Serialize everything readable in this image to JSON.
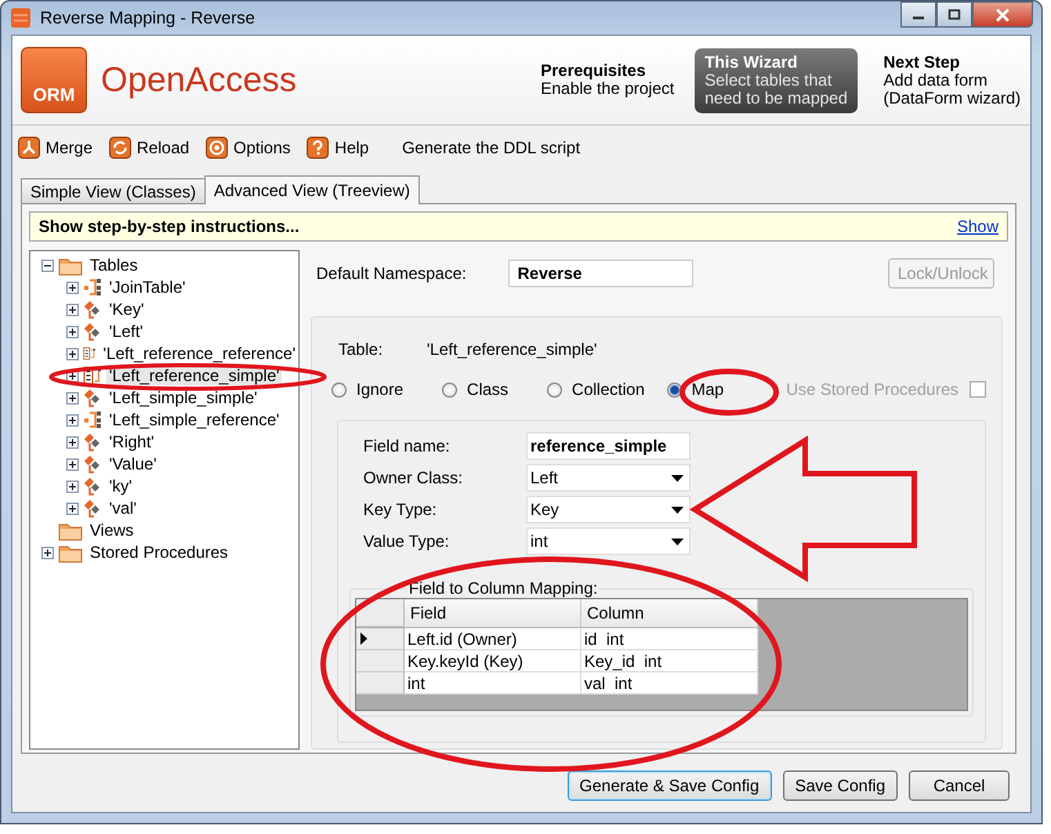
{
  "window": {
    "title": "Reverse Mapping - Reverse"
  },
  "header": {
    "logo_text": "ORM",
    "brand": "OpenAccess",
    "steps": [
      {
        "title": "Prerequisites",
        "lines": [
          "Enable the project"
        ],
        "selected": false
      },
      {
        "title": "This Wizard",
        "lines": [
          "Select tables that",
          "need to be mapped"
        ],
        "selected": true
      },
      {
        "title": "Next Step",
        "lines": [
          "Add data form",
          "(DataForm wizard)"
        ],
        "selected": false
      }
    ]
  },
  "toolbar": [
    {
      "label": "Merge",
      "kind": "merge"
    },
    {
      "label": "Reload",
      "kind": "reload"
    },
    {
      "label": "Options",
      "kind": "options"
    },
    {
      "label": "Help",
      "kind": "help"
    },
    {
      "label": "Generate the DDL script",
      "kind": "text"
    }
  ],
  "tabs": [
    {
      "label": "Simple View (Classes)",
      "selected": false
    },
    {
      "label": "Advanced View (Treeview)",
      "selected": true
    }
  ],
  "info_bar": {
    "text": "Show step-by-step instructions...",
    "link": "Show"
  },
  "tree": [
    {
      "label": "Tables",
      "expanded": true,
      "children": [
        {
          "label": "'JoinTable'",
          "kind": "join",
          "expanded": false,
          "selected": false
        },
        {
          "label": "'Key'",
          "kind": "class",
          "expanded": false,
          "selected": false
        },
        {
          "label": "'Left'",
          "kind": "class",
          "expanded": false,
          "selected": false
        },
        {
          "label": "'Left_reference_reference'",
          "kind": "map",
          "expanded": false,
          "selected": false
        },
        {
          "label": "'Left_reference_simple'",
          "kind": "map",
          "expanded": false,
          "selected": true
        },
        {
          "label": "'Left_simple_simple'",
          "kind": "class",
          "expanded": false,
          "selected": false
        },
        {
          "label": "'Left_simple_reference'",
          "kind": "join",
          "expanded": false,
          "selected": false
        },
        {
          "label": "'Right'",
          "kind": "class",
          "expanded": false,
          "selected": false
        },
        {
          "label": "'Value'",
          "kind": "class",
          "expanded": false,
          "selected": false
        },
        {
          "label": "'ky'",
          "kind": "class",
          "expanded": false,
          "selected": false
        },
        {
          "label": "'val'",
          "kind": "class",
          "expanded": false,
          "selected": false
        }
      ]
    },
    {
      "label": "Views",
      "kind": "leaf"
    },
    {
      "label": "Stored Procedures",
      "expanded": false,
      "kind": "folder"
    }
  ],
  "namespace": {
    "label": "Default Namespace:",
    "value": "Reverse"
  },
  "lock_button": {
    "label": "Lock/Unlock",
    "disabled": true
  },
  "table": {
    "label": "Table:",
    "name": "'Left_reference_simple'"
  },
  "mapping_options": [
    {
      "label": "Ignore",
      "selected": false
    },
    {
      "label": "Class",
      "selected": false
    },
    {
      "label": "Collection",
      "selected": false
    },
    {
      "label": "Map",
      "selected": true
    }
  ],
  "stored_procedures": {
    "label": "Use Stored Procedures",
    "checked": false,
    "disabled": true
  },
  "fields": [
    {
      "label": "Field name:",
      "value": "reference_simple",
      "kind": "text"
    },
    {
      "label": "Owner Class:",
      "value": "Left",
      "kind": "dropdown"
    },
    {
      "label": "Key Type:",
      "value": "Key",
      "kind": "dropdown"
    },
    {
      "label": "Value Type:",
      "value": "int",
      "kind": "dropdown"
    }
  ],
  "grid": {
    "title": "Field to Column Mapping:",
    "columns": [
      "Field",
      "Column"
    ],
    "rows": [
      {
        "selected": true,
        "cells": [
          "Left.id (Owner)",
          "id  int"
        ]
      },
      {
        "selected": false,
        "cells": [
          "Key.keyId (Key)",
          "Key_id  int"
        ]
      },
      {
        "selected": false,
        "cells": [
          "int",
          "val  int"
        ]
      }
    ]
  },
  "buttons": [
    {
      "label": "Generate & Save Config",
      "default": true
    },
    {
      "label": "Save Config",
      "default": false
    },
    {
      "label": "Cancel",
      "default": false
    }
  ]
}
